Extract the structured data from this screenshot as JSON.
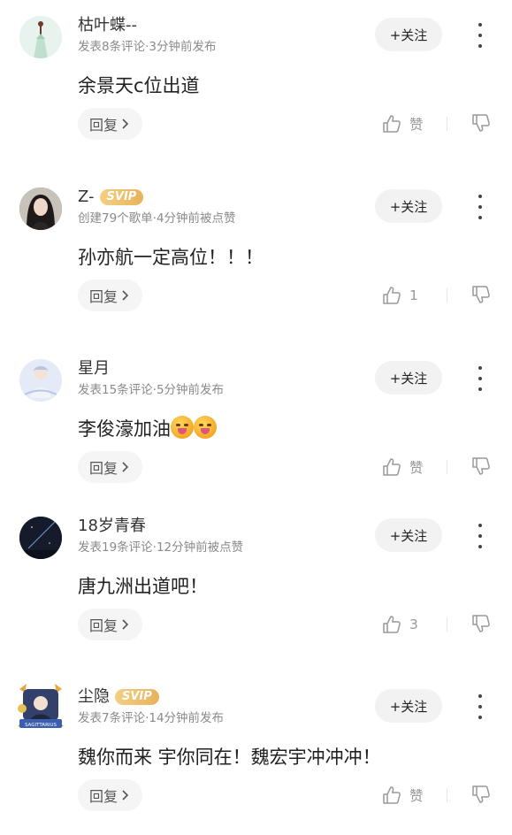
{
  "comments": [
    {
      "username": "枯叶蝶--",
      "svip": "",
      "meta": "发表8条评论·3分钟前发布",
      "content": "余景天c位出道",
      "emoji_count": 0,
      "follow_label": "+关注",
      "reply_label": "回复",
      "like_text": "赞",
      "avatar_icon": "flower-stem-avatar"
    },
    {
      "username": "Z-",
      "svip": "SVIP",
      "meta": "创建79个歌单·4分钟前被点赞",
      "content": "孙亦航一定高位！！！",
      "emoji_count": 0,
      "follow_label": "+关注",
      "reply_label": "回复",
      "like_text": "1",
      "avatar_icon": "girl-photo-avatar"
    },
    {
      "username": "星月",
      "svip": "",
      "meta": "发表15条评论·5分钟前发布",
      "content": "李俊濠加油",
      "emoji_count": 2,
      "follow_label": "+关注",
      "reply_label": "回复",
      "like_text": "赞",
      "avatar_icon": "anime-girl-avatar"
    },
    {
      "username": "18岁青春",
      "svip": "",
      "meta": "发表19条评论·12分钟前被点赞",
      "content": "唐九洲出道吧！",
      "emoji_count": 0,
      "follow_label": "+关注",
      "reply_label": "回复",
      "like_text": "3",
      "avatar_icon": "night-sky-avatar"
    },
    {
      "username": "尘隐",
      "svip": "SVIP",
      "meta": "发表7条评论·14分钟前发布",
      "content": "魏你而来 宇你同在！魏宏宇冲冲冲！",
      "emoji_count": 0,
      "follow_label": "+关注",
      "reply_label": "回复",
      "like_text": "赞",
      "avatar_icon": "sagittarius-badge-avatar",
      "avatar_badge_text": "SAGITTARIUS"
    }
  ],
  "colors": {
    "svip_gold": "#e7b35c",
    "meta_gray": "#8a8a8a",
    "button_bg": "#f2f2f2"
  }
}
